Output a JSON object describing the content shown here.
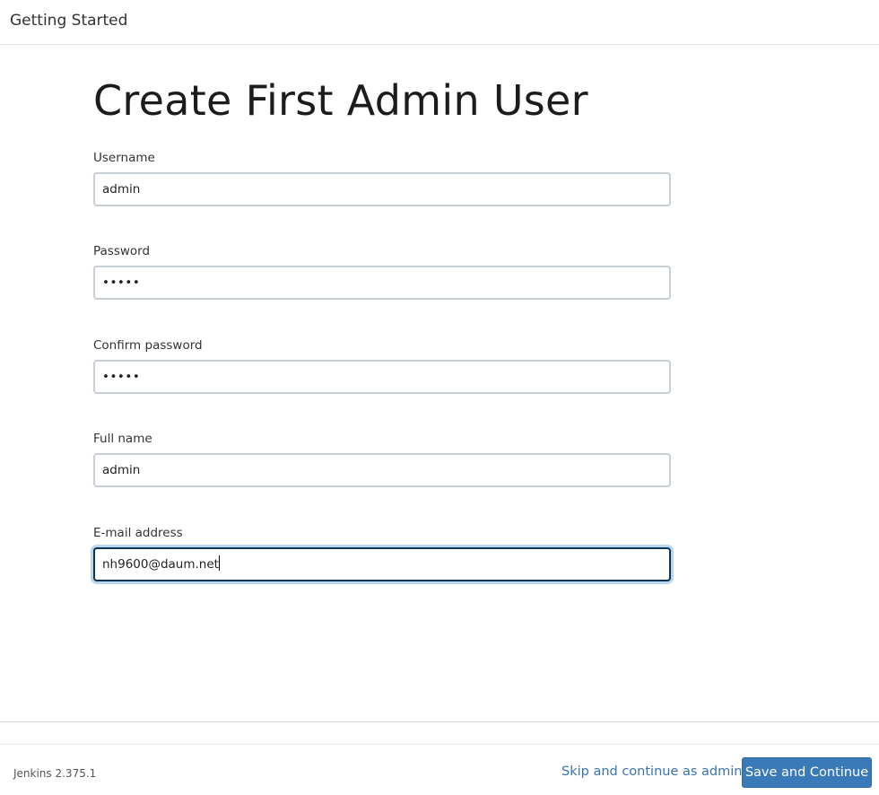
{
  "header": {
    "title": "Getting Started"
  },
  "main": {
    "title": "Create First Admin User",
    "fields": [
      {
        "label": "Username",
        "value": "admin",
        "type": "text"
      },
      {
        "label": "Password",
        "value": "•••••",
        "type": "password"
      },
      {
        "label": "Confirm password",
        "value": "•••••",
        "type": "password"
      },
      {
        "label": "Full name",
        "value": "admin",
        "type": "text"
      },
      {
        "label": "E-mail address",
        "value": "nh9600@daum.net",
        "type": "email",
        "focused": true
      }
    ]
  },
  "footer": {
    "version": "Jenkins 2.375.1",
    "skip_label": "Skip and continue as admin",
    "save_label": "Save and Continue"
  },
  "colors": {
    "accent": "#3b7ab8",
    "link": "#3a74b0",
    "focus_border": "#0d3553",
    "focus_ring": "#b9d7ee"
  }
}
